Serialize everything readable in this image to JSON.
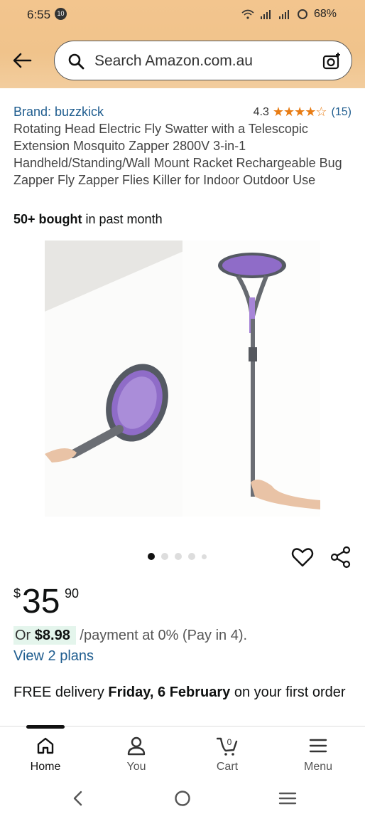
{
  "status": {
    "time": "6:55",
    "badge": "10",
    "battery": "68%"
  },
  "search": {
    "placeholder": "Search Amazon.com.au"
  },
  "product": {
    "brand": "Brand: buzzkick",
    "rating": "4.3",
    "review_count": "(15)",
    "title": "Rotating Head Electric Fly Swatter with a Telescopic Extension Mosquito Zapper 2800V 3-in-1 Handheld/Standing/Wall Mount Racket Rechargeable Bug Zapper Fly Zapper Flies Killer for Indoor Outdoor Use",
    "bought_bold": "50+ bought",
    "bought_rest": " in past month",
    "price_symbol": "$",
    "price_whole": "35",
    "price_fraction": "90",
    "payment_prefix": "Or ",
    "payment_amount": "$8.98",
    "payment_suffix": " /payment at 0% (Pay in 4).",
    "plans_link": "View 2 plans",
    "delivery_prefix": "FREE delivery ",
    "delivery_date": "Friday, 6 February",
    "delivery_suffix": " on your first order"
  },
  "carousel": {
    "count": 5,
    "active_index": 0
  },
  "cart_count": "0",
  "nav": {
    "home": "Home",
    "you": "You",
    "cart": "Cart",
    "menu": "Menu"
  },
  "colors": {
    "accent_link": "#1f5d8f",
    "star": "#e87c14",
    "header_bg": "#f3c58e"
  }
}
